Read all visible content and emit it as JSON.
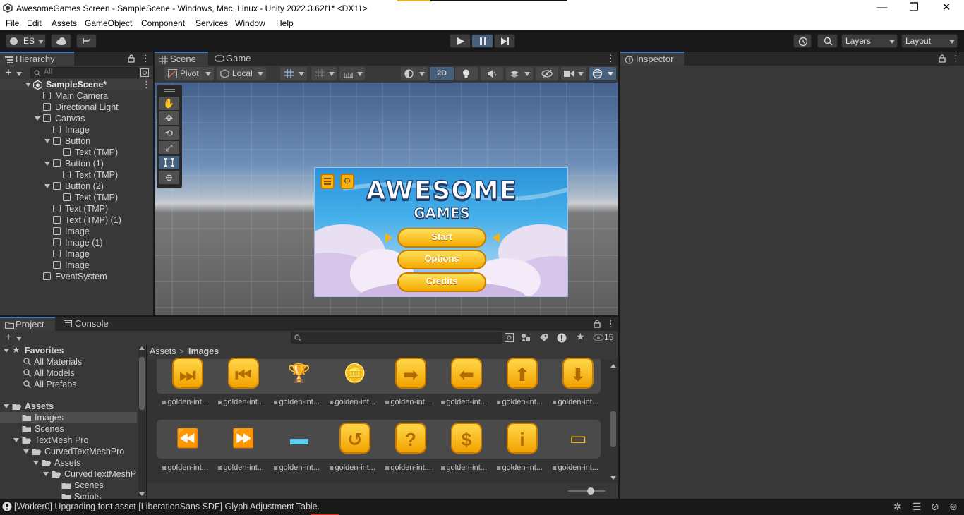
{
  "window": {
    "title": "AwesomeGames Screen - SampleScene - Windows, Mac, Linux - Unity 2022.3.62f1* <DX11>",
    "minimize": "—",
    "maximize": "❐",
    "close": "✕"
  },
  "menu": [
    "File",
    "Edit",
    "Assets",
    "GameObject",
    "Component",
    "Services",
    "Window",
    "Help"
  ],
  "toolbar": {
    "account": "ES",
    "layers_label": "Layers",
    "layout_label": "Layout"
  },
  "hierarchy": {
    "tab_label": "Hierarchy",
    "search_placeholder": "All",
    "scene_name": "SampleScene*",
    "items": [
      {
        "label": "Main Camera",
        "indent": 1,
        "expand": false
      },
      {
        "label": "Directional Light",
        "indent": 1,
        "expand": false
      },
      {
        "label": "Canvas",
        "indent": 1,
        "expand": true
      },
      {
        "label": "Image",
        "indent": 2,
        "expand": false
      },
      {
        "label": "Button",
        "indent": 2,
        "expand": true
      },
      {
        "label": "Text (TMP)",
        "indent": 3,
        "expand": false
      },
      {
        "label": "Button (1)",
        "indent": 2,
        "expand": true
      },
      {
        "label": "Text (TMP)",
        "indent": 3,
        "expand": false
      },
      {
        "label": "Button (2)",
        "indent": 2,
        "expand": true
      },
      {
        "label": "Text (TMP)",
        "indent": 3,
        "expand": false
      },
      {
        "label": "Text (TMP)",
        "indent": 2,
        "expand": false
      },
      {
        "label": "Text (TMP) (1)",
        "indent": 2,
        "expand": false
      },
      {
        "label": "Image",
        "indent": 2,
        "expand": false
      },
      {
        "label": "Image (1)",
        "indent": 2,
        "expand": false
      },
      {
        "label": "Image",
        "indent": 2,
        "expand": false
      },
      {
        "label": "Image",
        "indent": 2,
        "expand": false
      },
      {
        "label": "EventSystem",
        "indent": 1,
        "expand": false
      }
    ]
  },
  "scene": {
    "tab_scene": "Scene",
    "tab_game": "Game",
    "pivot_label": "Pivot",
    "local_label": "Local",
    "mode_2d": "2D",
    "game_title_line1": "AWESOME",
    "game_title_line2": "GAMES",
    "buttons": [
      "Start",
      "Options",
      "Credits"
    ]
  },
  "inspector": {
    "tab_label": "Inspector"
  },
  "project": {
    "tab_project": "Project",
    "tab_console": "Console",
    "hidden_count": "15",
    "favorites_label": "Favorites",
    "favorites": [
      "All Materials",
      "All Models",
      "All Prefabs"
    ],
    "tree": [
      {
        "label": "Assets",
        "indent": 0,
        "expand": true,
        "bold": true
      },
      {
        "label": "Images",
        "indent": 1,
        "expand": false,
        "selected": true
      },
      {
        "label": "Scenes",
        "indent": 1,
        "expand": false
      },
      {
        "label": "TextMesh Pro",
        "indent": 1,
        "expand": true
      },
      {
        "label": "CurvedTextMeshPro",
        "indent": 2,
        "expand": true
      },
      {
        "label": "Assets",
        "indent": 3,
        "expand": true
      },
      {
        "label": "CurvedTextMeshP",
        "indent": 4,
        "expand": true
      },
      {
        "label": "Scenes",
        "indent": 5,
        "expand": false
      },
      {
        "label": "Scripts",
        "indent": 5,
        "expand": false
      }
    ],
    "breadcrumb": [
      "Assets",
      "Images"
    ],
    "asset_label": "golden-int...",
    "row1_icons": [
      "next-track-icon",
      "previous-track-icon",
      "trophy-icon",
      "coins-icon",
      "arrow-right-icon",
      "arrow-left-icon",
      "arrow-up-icon",
      "arrow-down-icon"
    ],
    "row2_icons": [
      "rewind-icon",
      "fast-forward-icon",
      "bar-icon",
      "restart-icon",
      "question-icon",
      "dollar-icon",
      "info-icon",
      "slider-icon"
    ]
  },
  "status": {
    "message": "[Worker0] Upgrading font asset [LiberationSans SDF] Glyph Adjustment Table."
  }
}
